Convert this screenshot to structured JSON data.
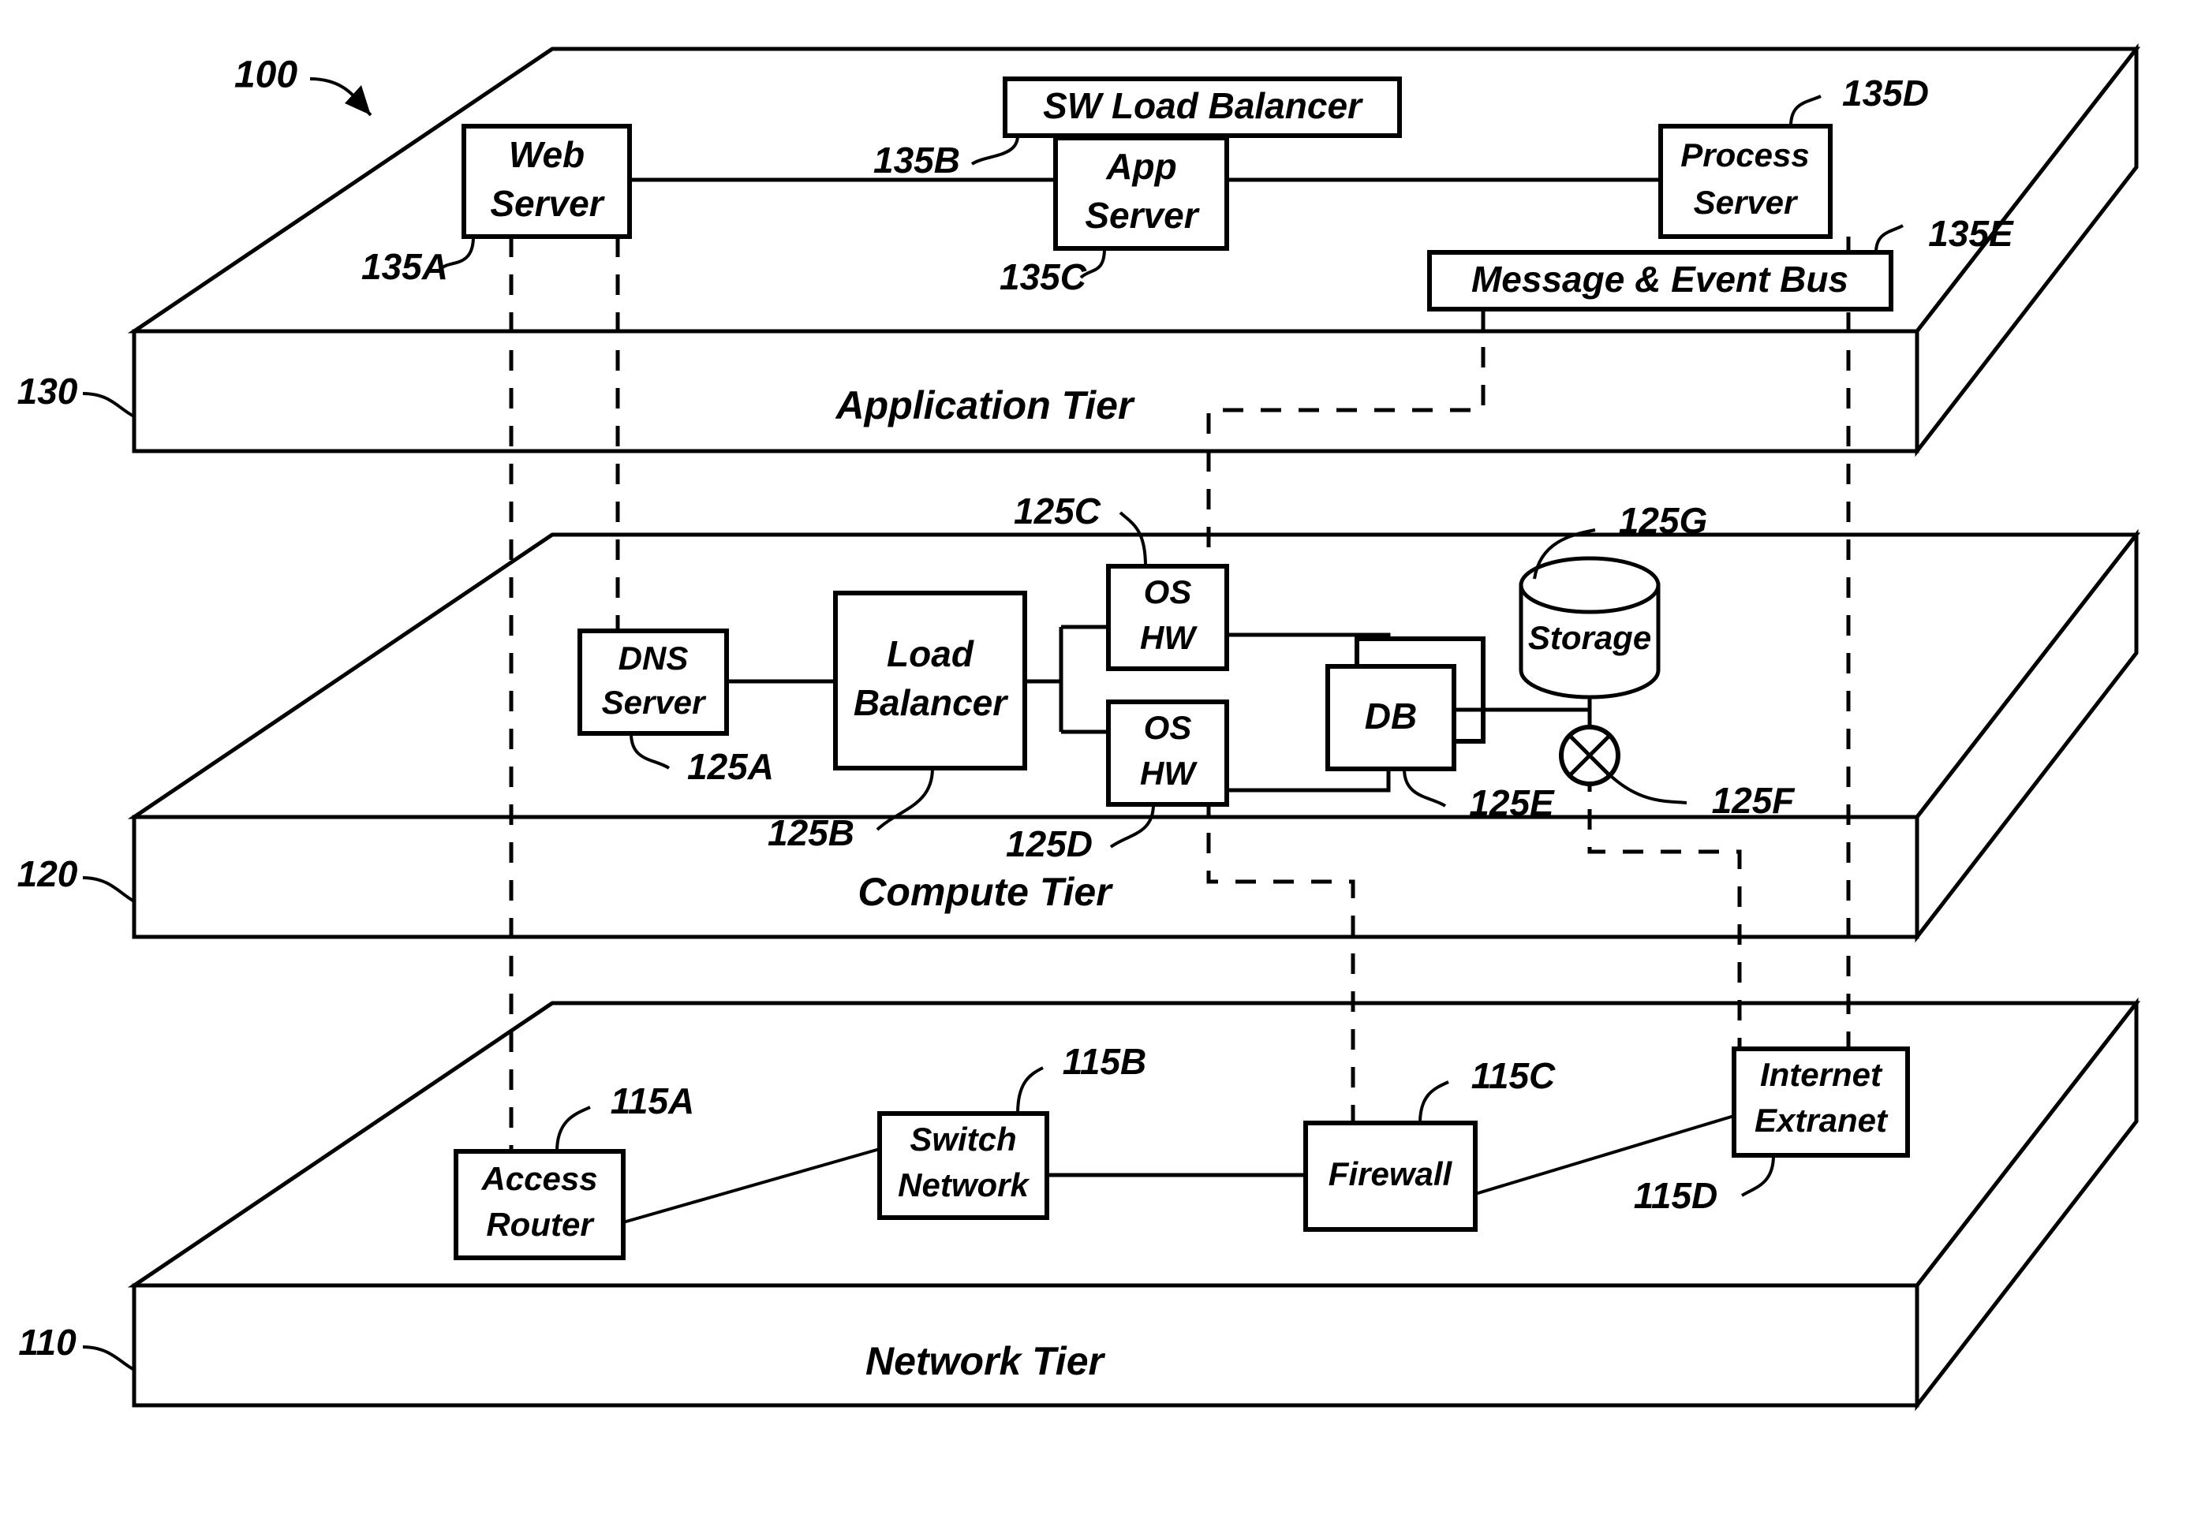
{
  "figure": {
    "figure_ref": "100"
  },
  "tiers": [
    {
      "id": "application",
      "ref": "130",
      "label": "Application Tier"
    },
    {
      "id": "compute",
      "ref": "120",
      "label": "Compute Tier"
    },
    {
      "id": "network",
      "ref": "110",
      "label": "Network Tier"
    }
  ],
  "application_tier": {
    "nodes": [
      {
        "ref": "135A",
        "label_line1": "Web",
        "label_line2": "Server"
      },
      {
        "ref": "135B",
        "label_line1": "SW Load Balancer",
        "label_line2": ""
      },
      {
        "ref": "135C",
        "label_line1": "App",
        "label_line2": "Server"
      },
      {
        "ref": "135D",
        "label_line1": "Process",
        "label_line2": "Server"
      },
      {
        "ref": "135E",
        "label_line1": "Message & Event Bus",
        "label_line2": ""
      }
    ]
  },
  "compute_tier": {
    "nodes": [
      {
        "ref": "125A",
        "label_line1": "DNS",
        "label_line2": "Server"
      },
      {
        "ref": "125B",
        "label_line1": "Load",
        "label_line2": "Balancer"
      },
      {
        "ref": "125C",
        "label_line1": "OS",
        "label_line2": "HW"
      },
      {
        "ref": "125D",
        "label_line1": "OS",
        "label_line2": "HW"
      },
      {
        "ref": "125E",
        "label_line1": "DB",
        "label_line2": ""
      },
      {
        "ref": "125F",
        "label_line1": "",
        "label_line2": ""
      },
      {
        "ref": "125G",
        "label_line1": "Storage",
        "label_line2": ""
      }
    ]
  },
  "network_tier": {
    "nodes": [
      {
        "ref": "115A",
        "label_line1": "Access",
        "label_line2": "Router"
      },
      {
        "ref": "115B",
        "label_line1": "Switch",
        "label_line2": "Network"
      },
      {
        "ref": "115C",
        "label_line1": "Firewall",
        "label_line2": ""
      },
      {
        "ref": "115D",
        "label_line1": "Internet",
        "label_line2": "Extranet"
      }
    ]
  }
}
